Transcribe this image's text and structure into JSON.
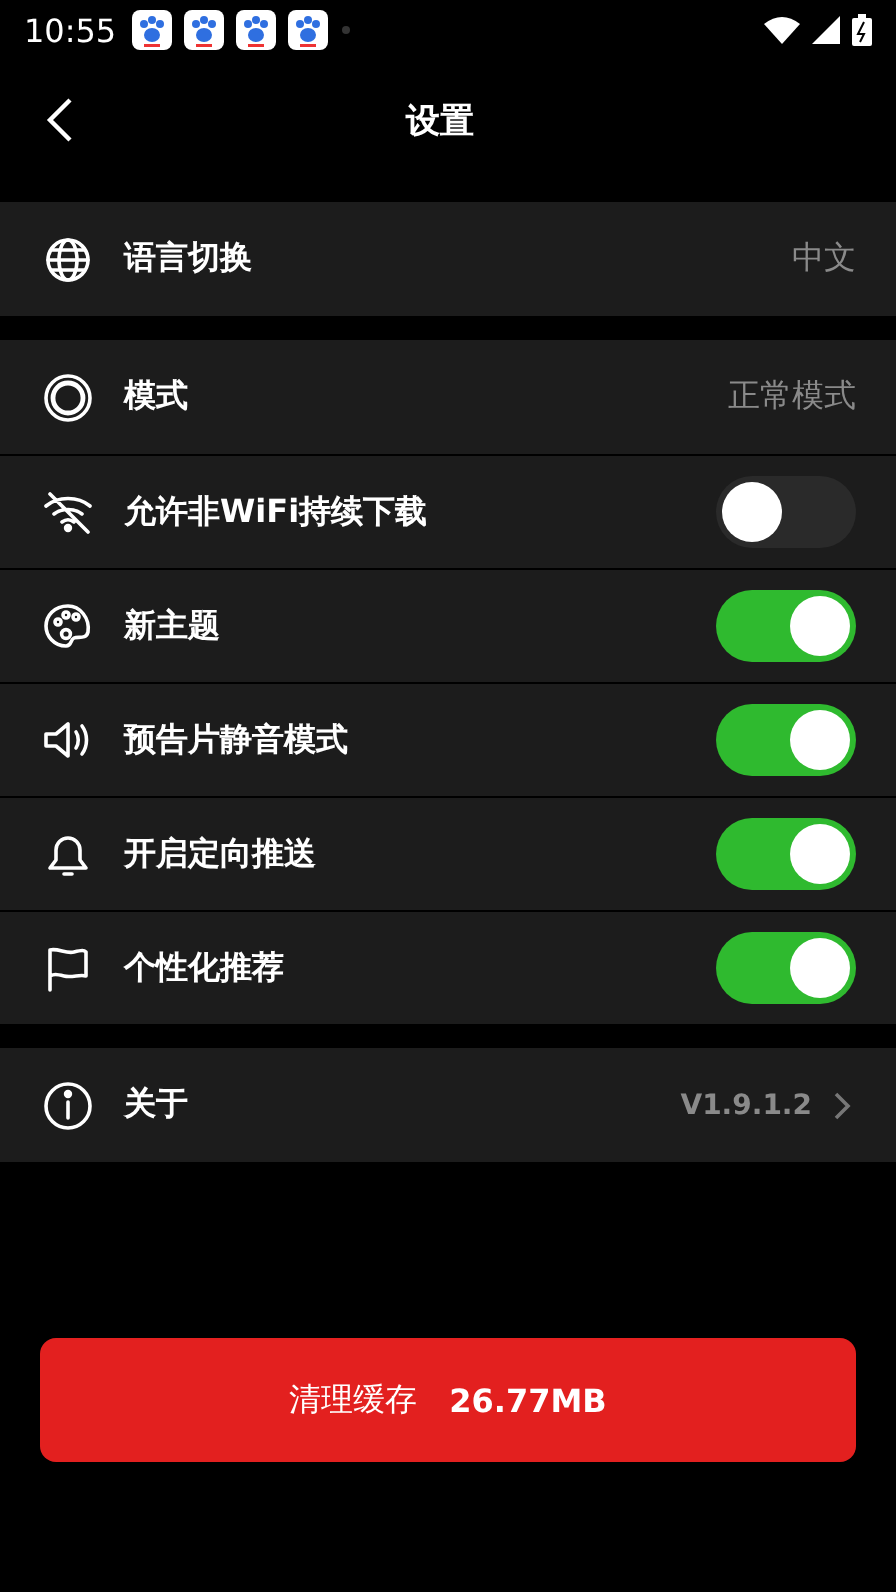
{
  "status_bar": {
    "time": "10:55"
  },
  "header": {
    "title": "设置"
  },
  "sections": [
    {
      "rows": [
        {
          "label": "语言切换",
          "kind": "value",
          "value": "中文"
        }
      ]
    },
    {
      "rows": [
        {
          "label": "模式",
          "kind": "value",
          "value": "正常模式"
        },
        {
          "label": "允许非WiFi持续下载",
          "kind": "toggle",
          "on": false
        },
        {
          "label": "新主题",
          "kind": "toggle",
          "on": true
        },
        {
          "label": "预告片静音模式",
          "kind": "toggle",
          "on": true
        },
        {
          "label": "开启定向推送",
          "kind": "toggle",
          "on": true
        },
        {
          "label": "个性化推荐",
          "kind": "toggle",
          "on": true
        }
      ]
    },
    {
      "rows": [
        {
          "label": "关于",
          "kind": "link",
          "value": "V1.9.1.2"
        }
      ]
    }
  ],
  "clear_button": {
    "label": "清理缓存",
    "size": "26.77MB"
  }
}
